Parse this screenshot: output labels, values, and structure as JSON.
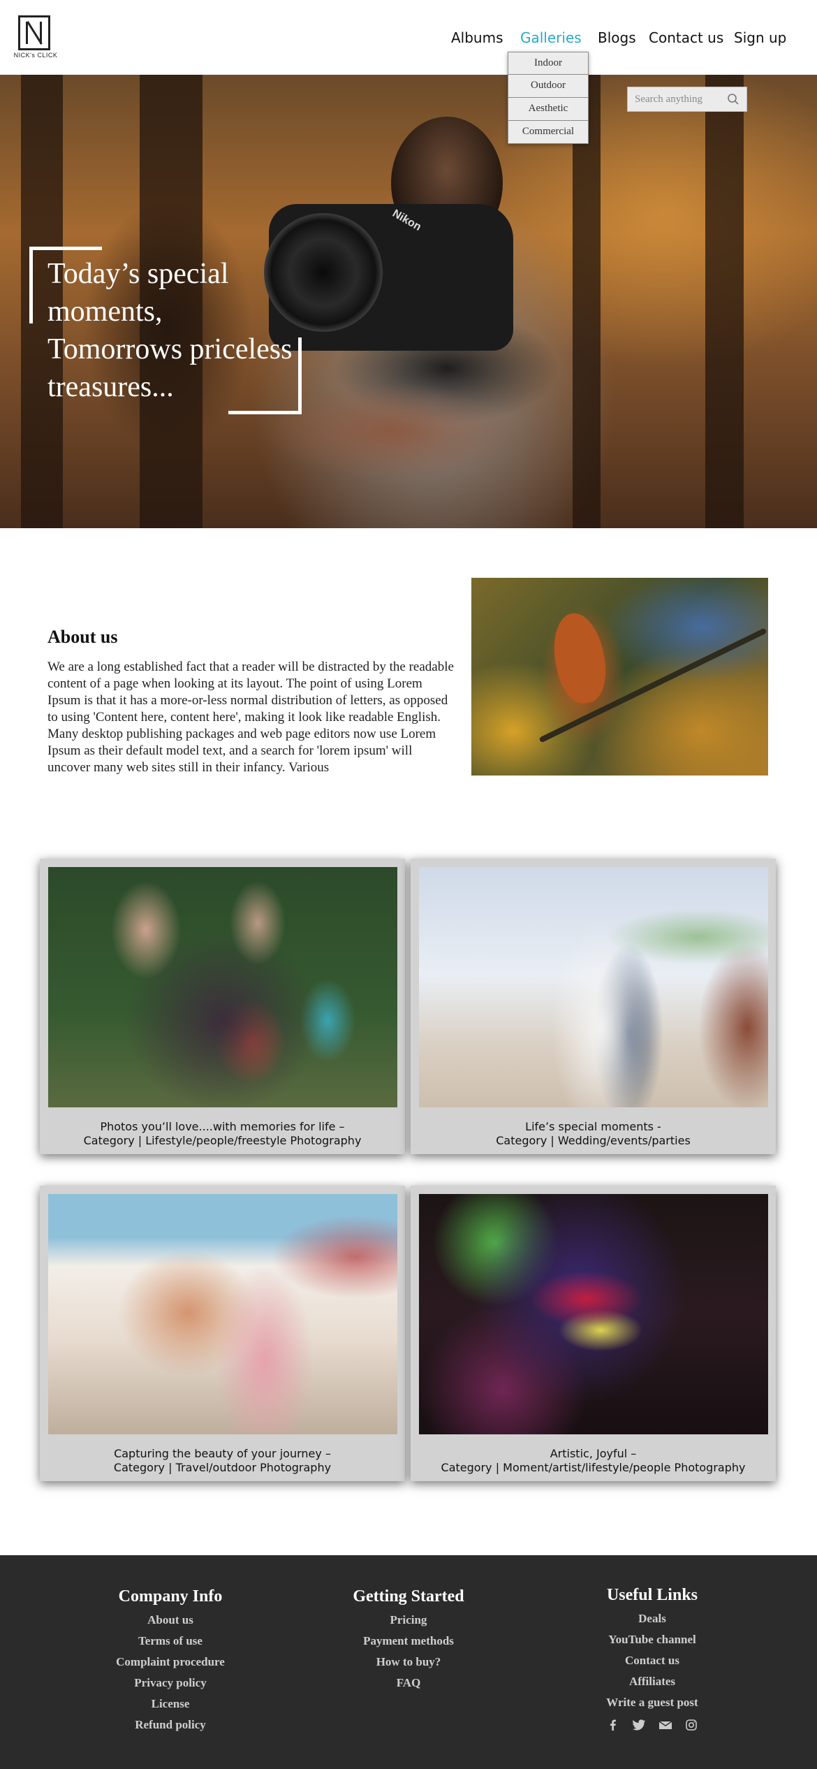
{
  "header": {
    "logo_text": "NICK's CLICK",
    "nav": [
      "Albums",
      "Galleries",
      "Blogs",
      "Contact us",
      "Sign up"
    ],
    "active_nav": "Galleries",
    "accent_color": "#27a9c9",
    "galleries_dropdown": [
      "Indoor",
      "Outdoor",
      "Aesthetic",
      "Commercial"
    ]
  },
  "hero": {
    "search_placeholder": "Search anything",
    "headline_lines": [
      "Today’s special",
      "moments,",
      "Tomorrows priceless",
      "treasures..."
    ],
    "camera_brand": "Nikon"
  },
  "about": {
    "title": "About us",
    "body": "We are a long established fact that a reader will be distracted by the readable content of a page when looking at its layout. The point of using Lorem Ipsum is that it has a more-or-less normal distribution of letters, as opposed to using 'Content here, content here', making it look like readable English. Many desktop publishing packages and web page editors now use Lorem Ipsum as their default model text, and a search for 'lorem ipsum' will uncover many web sites still in their infancy. Various"
  },
  "gallery": [
    {
      "caption": "Photos you’ll love....with memories for life –",
      "category": "Category | Lifestyle/people/freestyle Photography"
    },
    {
      "caption": "Life’s special moments -",
      "category": "Category | Wedding/events/parties"
    },
    {
      "caption": "Capturing the beauty of your journey –",
      "category": "Category | Travel/outdoor Photography"
    },
    {
      "caption": "Artistic, Joyful –",
      "category": "Category | Moment/artist/lifestyle/people Photography"
    }
  ],
  "footer": {
    "company_info": {
      "title": "Company Info",
      "links": [
        "About us",
        "Terms of use",
        "Complaint procedure",
        "Privacy policy",
        "License",
        "Refund policy"
      ]
    },
    "getting_started": {
      "title": "Getting Started",
      "links": [
        "Pricing",
        "Payment methods",
        "How to buy?",
        "FAQ"
      ]
    },
    "useful_links": {
      "title": "Useful Links",
      "links": [
        "Deals",
        "YouTube channel",
        "Contact us",
        "Affiliates",
        "Write a guest post"
      ]
    },
    "social_icons": [
      "facebook-icon",
      "twitter-icon",
      "email-icon",
      "instagram-icon"
    ]
  }
}
